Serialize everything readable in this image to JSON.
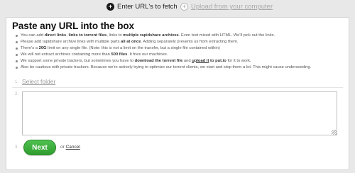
{
  "topnav": {
    "fetch": {
      "icon": "plus-icon",
      "glyph": "+",
      "label": "Enter URL's to fetch"
    },
    "upload": {
      "icon": "plus-icon",
      "glyph": "+",
      "label": "Upload from your computer"
    }
  },
  "panel": {
    "title": "Paste any URL into the box",
    "rules": [
      {
        "parts": [
          {
            "t": "You can add "
          },
          {
            "t": "direct links",
            "b": true
          },
          {
            "t": ", "
          },
          {
            "t": "links to torrent files",
            "b": true
          },
          {
            "t": ", links to "
          },
          {
            "t": "multiple rapidshare archives",
            "b": true
          },
          {
            "t": ". Even text mixed with HTML. We'll pick out the links."
          }
        ]
      },
      {
        "parts": [
          {
            "t": "Please add rapidshare archive links with multiple parts "
          },
          {
            "t": "all at once",
            "b": true
          },
          {
            "t": ". Adding separately prevents us from extracting them."
          }
        ]
      },
      {
        "parts": [
          {
            "t": "There's a "
          },
          {
            "t": "20G",
            "b": true
          },
          {
            "t": " limit on any single file. (Note: this is not a limit on the transfer, but a single file contained within)"
          }
        ]
      },
      {
        "parts": [
          {
            "t": "We will not extract archives containing more than "
          },
          {
            "t": "500 files",
            "b": true
          },
          {
            "t": ". It fries our machines."
          }
        ]
      },
      {
        "parts": [
          {
            "t": "We support some private trackers, but sometimes you have to "
          },
          {
            "t": "download the torrent file",
            "b": true
          },
          {
            "t": " and "
          },
          {
            "t": "upload it",
            "u": true
          },
          {
            "t": " to put.io",
            "b": true
          },
          {
            "t": " for it to work."
          }
        ]
      },
      {
        "parts": [
          {
            "t": "Also be cautious with private trackers. Because we're actively trying to optimize our torrent clients, we start and stop them a lot. This might cause underseeding."
          }
        ]
      }
    ],
    "steps": {
      "one": "1.",
      "two": "2.",
      "three": "3."
    },
    "select_folder": "Select folder",
    "url_input": {
      "value": "",
      "placeholder": ""
    },
    "next_label": "Next",
    "or_text": "or",
    "cancel_label": "Cancel"
  },
  "colors": {
    "accent_green": "#3aad3a",
    "page_bg": "#e8e8e8"
  }
}
